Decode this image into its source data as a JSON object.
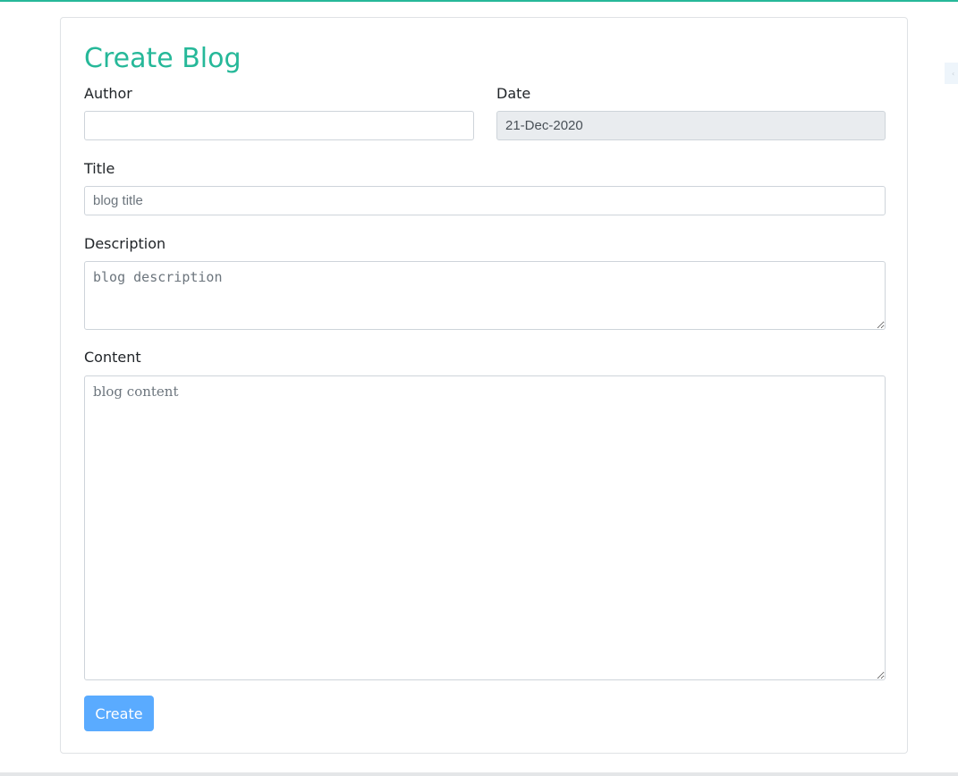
{
  "colors": {
    "accent": "#26b899",
    "button": "#5aabff"
  },
  "form": {
    "heading": "Create Blog",
    "author": {
      "label": "Author",
      "value": "",
      "placeholder": ""
    },
    "date": {
      "label": "Date",
      "value": "21-Dec-2020"
    },
    "title": {
      "label": "Title",
      "placeholder": "blog title"
    },
    "description": {
      "label": "Description",
      "placeholder": "blog description"
    },
    "content": {
      "label": "Content",
      "placeholder": "blog content"
    },
    "submit_label": "Create"
  }
}
